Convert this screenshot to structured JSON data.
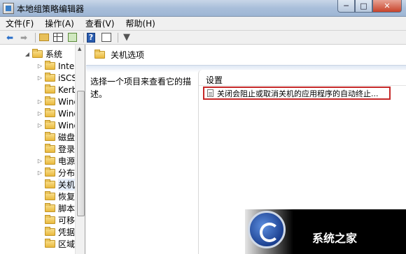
{
  "window": {
    "title": "本地组策略编辑器",
    "controls": [
      "─",
      "□",
      "✕"
    ]
  },
  "menu": [
    {
      "label": "文件(F)"
    },
    {
      "label": "操作(A)"
    },
    {
      "label": "查看(V)"
    },
    {
      "label": "帮助(H)"
    }
  ],
  "toolbar": {
    "icons": [
      "back-arrow-icon",
      "forward-arrow-icon",
      "folder-up-icon",
      "show-hide-tree-icon",
      "export-list-icon",
      "help-icon",
      "properties-icon",
      "filter-icon"
    ]
  },
  "tree": {
    "items": [
      {
        "label": "系统",
        "expander": "◢"
      },
      {
        "label": "Inter",
        "expander": "▷"
      },
      {
        "label": "iSCS",
        "expander": "▷"
      },
      {
        "label": "Kerb",
        "expander": ""
      },
      {
        "label": "Wind",
        "expander": "▷"
      },
      {
        "label": "Wind",
        "expander": "▷"
      },
      {
        "label": "Wind",
        "expander": "▷"
      },
      {
        "label": "磁盘",
        "expander": ""
      },
      {
        "label": "登录",
        "expander": ""
      },
      {
        "label": "电源",
        "expander": "▷"
      },
      {
        "label": "分布",
        "expander": "▷"
      },
      {
        "label": "关机",
        "expander": "",
        "selected": true
      },
      {
        "label": "恢复",
        "expander": ""
      },
      {
        "label": "脚本",
        "expander": ""
      },
      {
        "label": "可移",
        "expander": ""
      },
      {
        "label": "凭据",
        "expander": ""
      },
      {
        "label": "区域",
        "expander": ""
      }
    ]
  },
  "pane": {
    "title": "关机选项",
    "description": "选择一个项目来查看它的描述。",
    "column_header": "设置",
    "setting": "关闭会阻止或取消关机的应用程序的自动终止..."
  },
  "watermark": {
    "brand": "系统之家"
  }
}
